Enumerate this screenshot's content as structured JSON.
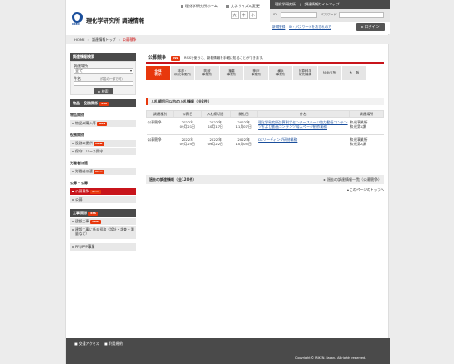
{
  "header": {
    "logo_text": "RIKEN",
    "site_title": "理化学研究所 調達情報",
    "top_links": [
      "理化学研究所ホーム",
      "文字サイズの変更"
    ],
    "font_sizes": [
      "大",
      "中",
      "小"
    ],
    "topbar_links": [
      "理化学研究所",
      "調達情報サイトマップ"
    ],
    "login": {
      "id_label": "ID",
      "pw_label": "パスワード"
    },
    "links": [
      "新規登録",
      "ID・パスワードをお忘れの方"
    ],
    "login_button": "ログイン"
  },
  "breadcrumb": [
    "HOME",
    "調達情報トップ",
    "公募競争"
  ],
  "sidebar": {
    "search_title": "調達情報検索",
    "place_label": "調達場所",
    "place_value": "全て",
    "name_label": "件名",
    "name_hint": "（件名の一部で可）",
    "search_button": "検索",
    "sections": [
      {
        "title": "物品・役務関係",
        "badge": "RSS",
        "groups": [
          {
            "title": "物品関係",
            "items": [
              {
                "label": "物品の購入等",
                "badge": "New",
                "active": false
              }
            ]
          },
          {
            "title": "役務関係",
            "items": [
              {
                "label": "役務の提供",
                "badge": "New",
                "active": false
              },
              {
                "label": "保守・リース保守",
                "badge": "",
                "active": false
              }
            ]
          },
          {
            "title": "労働者派遣",
            "items": [
              {
                "label": "労働者派遣",
                "badge": "New",
                "active": false
              }
            ]
          },
          {
            "title": "公募・公募",
            "items": [
              {
                "label": "公募競争",
                "badge": "New",
                "active": true
              },
              {
                "label": "公募",
                "badge": "",
                "active": false
              }
            ]
          }
        ]
      },
      {
        "title": "工事関係",
        "badge": "RSS",
        "groups": [
          {
            "title": "",
            "items": [
              {
                "label": "建設工事",
                "badge": "New",
                "active": false
              },
              {
                "label": "建設工事に係る役務（設計・調査・測量など）",
                "badge": "",
                "active": false
              }
            ]
          }
        ]
      }
    ],
    "pfi": "PFI/PPP事業"
  },
  "main": {
    "title": "公募競争",
    "rss": "RSS",
    "lead": "RSSを使うと、新着情報を手軽に知ることができます。",
    "tabs": [
      {
        "lines": [
          "全体",
          "表示"
        ],
        "on": true
      },
      {
        "lines": [
          "本部・",
          "和光事業所"
        ],
        "on": false
      },
      {
        "lines": [
          "筑波",
          "事業所"
        ],
        "on": false
      },
      {
        "lines": [
          "播磨",
          "事業所"
        ],
        "on": false
      },
      {
        "lines": [
          "神戸",
          "事業所"
        ],
        "on": false
      },
      {
        "lines": [
          "横浜",
          "事業所"
        ],
        "on": false
      },
      {
        "lines": [
          "計算科学",
          "研究機構"
        ],
        "on": false
      },
      {
        "lines": [
          "仙台支所"
        ],
        "on": false
      },
      {
        "lines": [
          "大　阪"
        ],
        "on": false
      }
    ],
    "current_heading": "入札締切日以内の入札情報（全2件）",
    "columns": [
      "調達種別",
      "公表日",
      "入札締切日",
      "開札日",
      "件名",
      "調達場所"
    ],
    "rows": [
      {
        "type": "公募競争",
        "published": "2022年\n09月21日",
        "deadline": "2022年\n10月17日",
        "opening": "2022年\n11月07日",
        "subject": "理化学研究所計算科学センターステージ協力動画コンテンツおよび動画コンテンツ導入ページ制作業務",
        "place": "和光事業所\n和光第1課"
      },
      {
        "type": "公募競争",
        "published": "2022年\n09月25日",
        "deadline": "2022年\n09月22日",
        "opening": "2022年\n10月05日",
        "subject": "DXリーディング研修業務",
        "place": "和光事業所\n和光第2課"
      }
    ],
    "past_heading": "過去の調達情報（全120件）",
    "past_link": "過去の調達情報一覧（公募競争）",
    "totop": "このページのトップへ"
  },
  "footer": {
    "links": [
      "交通アクセス",
      "利用規約"
    ],
    "copyright": "Copyright © RIKEN, Japan. All rights reserved."
  }
}
